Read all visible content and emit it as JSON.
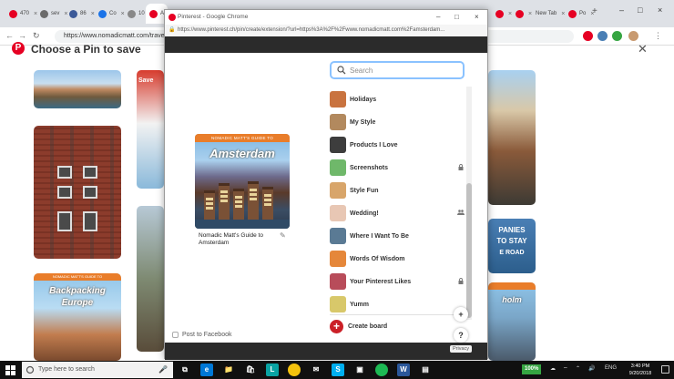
{
  "browser": {
    "tabs": [
      {
        "label": "470",
        "color": "#e60023"
      },
      {
        "label": "sev",
        "color": "#6b6b6b"
      },
      {
        "label": "86",
        "color": "#3b5998"
      },
      {
        "label": "Co",
        "color": "#1a73e8"
      },
      {
        "label": "10",
        "color": "#888888"
      },
      {
        "label": "Ak",
        "color": "#e60023"
      }
    ],
    "right_tabs": [
      {
        "label": "New Tab",
        "color": "#888888"
      },
      {
        "label": "Po",
        "color": "#e60023"
      }
    ],
    "url": "https://www.nomadicmatt.com/trave"
  },
  "background": {
    "title": "Choose a Pin to save",
    "book_band": "NOMADIC MATT'S GUIDE TO",
    "book_title_1": "Backpacking",
    "book_title_2": "Europe",
    "red_card_label": "Save",
    "card_text_a": "PANIES",
    "card_text_b": "TO STAY",
    "card_text_c": "E ROAD",
    "card_text_d": "holm"
  },
  "popup": {
    "window_title": "Pinterest - Google Chrome",
    "url": "https://www.pinterest.ch/pin/create/extension/?url=https%3A%2F%2Fwww.nomadicmatt.com%2Famsterdam...",
    "pin": {
      "band": "NOMADIC MATT'S GUIDE TO",
      "title": "Amsterdam",
      "description": "Nomadic Matt's Guide to Amsterdam"
    },
    "post_to_facebook": "Post to Facebook",
    "search": {
      "placeholder": "Search",
      "value": ""
    },
    "boards": [
      {
        "name": "Holidays",
        "marker": "",
        "thumb": "#c9733f"
      },
      {
        "name": "My Style",
        "marker": "",
        "thumb": "#b2895e"
      },
      {
        "name": "Products I Love",
        "marker": "",
        "thumb": "#3d3d3d"
      },
      {
        "name": "Screenshots",
        "marker": "lock-icon",
        "thumb": "#6fb86a"
      },
      {
        "name": "Style Fun",
        "marker": "",
        "thumb": "#d8a56a"
      },
      {
        "name": "Wedding!",
        "marker": "group-icon",
        "thumb": "#e8c7b4"
      },
      {
        "name": "Where I Want To Be",
        "marker": "",
        "thumb": "#5a7a94"
      },
      {
        "name": "Words Of Wisdom",
        "marker": "",
        "thumb": "#e5873a"
      },
      {
        "name": "Your Pinterest Likes",
        "marker": "lock-icon",
        "thumb": "#b84c5a"
      },
      {
        "name": "Yumm",
        "marker": "",
        "thumb": "#d8c86a"
      }
    ],
    "create_board": "Create board",
    "plus_symbol": "+",
    "help_symbol": "?",
    "privacy": "Privacy"
  },
  "taskbar": {
    "search_placeholder": "Type here to search",
    "battery": "100%",
    "lang": "ENG",
    "time": "3:40 PM",
    "date": "9/20/2018"
  },
  "colors": {
    "pinterest_red": "#e60023",
    "create_red": "#cb2027",
    "search_focus": "#8ac2ff",
    "taskbar": "#101010",
    "battery_green": "#36a542"
  }
}
